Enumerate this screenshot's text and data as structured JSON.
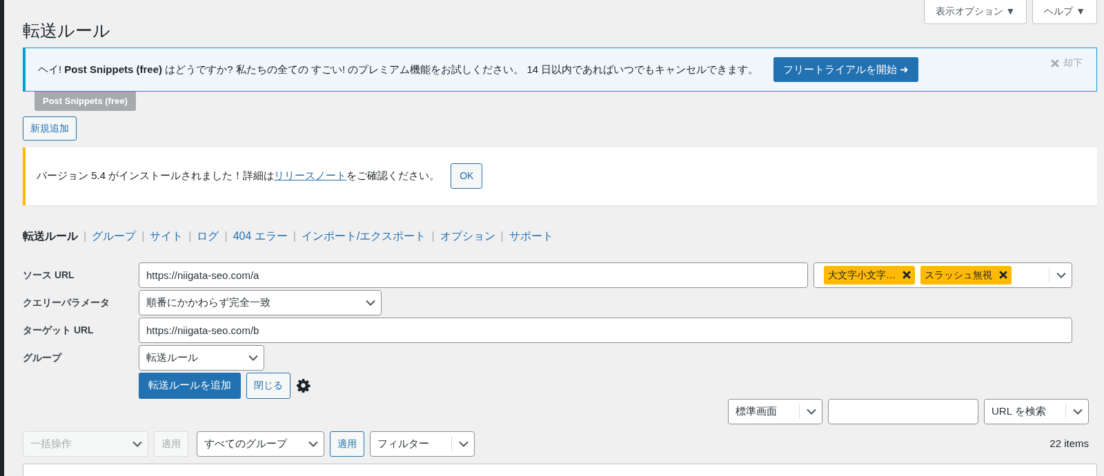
{
  "screen_meta": {
    "buttons": [
      {
        "label": "表示オプション ▼"
      },
      {
        "label": "ヘルプ ▼"
      }
    ]
  },
  "page_title": "転送ルール",
  "promo_notice": {
    "text": "ヘイ! **Post Snippets (free)** はどうですか? 私たちの全ての すごい! のプレミアム機能をお試しください。 14 日以内であればいつでもキャンセルできます。",
    "button": "フリートライアルを開始 ➜",
    "dismiss": "却下",
    "tag": "Post Snippets (free)"
  },
  "add_new_button": "新規追加",
  "update_notice": {
    "before": "バージョン 5.4 がインストールされました！詳細は",
    "link": "リリースノート",
    "after": "をご確認ください。",
    "button": "OK"
  },
  "nav": {
    "separator": "|",
    "items": [
      {
        "label": "転送ルール",
        "selected": true
      },
      {
        "label": "グループ",
        "selected": false
      },
      {
        "label": "サイト",
        "selected": false
      },
      {
        "label": "ログ",
        "selected": false
      },
      {
        "label": "404 エラー",
        "selected": false
      },
      {
        "label": "インポート/エクスポート",
        "selected": false
      },
      {
        "label": "オプション",
        "selected": false
      },
      {
        "label": "サポート",
        "selected": false
      }
    ]
  },
  "form": {
    "rows": [
      {
        "kind": "url",
        "label": "ソース URL",
        "value": "https://niigata-seo.com/a",
        "flags": [
          "大文字小文字…",
          "スラッシュ無視"
        ]
      },
      {
        "kind": "select",
        "label": "クエリーパラメータ",
        "value": "順番にかかわらず完全一致"
      },
      {
        "kind": "input",
        "label": "ターゲット URL",
        "value": "https://niigata-seo.com/b"
      },
      {
        "kind": "select",
        "label": "グループ",
        "value": "転送ルール"
      }
    ],
    "submit": "転送ルールを追加",
    "close": "閉じる"
  },
  "search_bar": {
    "display": "標準画面",
    "search_by": "URL を検索"
  },
  "bulk": {
    "action": {
      "value": "一括操作",
      "disabled": true
    },
    "apply": {
      "label": "適用",
      "disabled": true
    },
    "group": {
      "value": "すべてのグループ"
    },
    "group_apply": {
      "label": "適用",
      "disabled": false
    },
    "filter": "フィルター",
    "count": "22 items"
  }
}
